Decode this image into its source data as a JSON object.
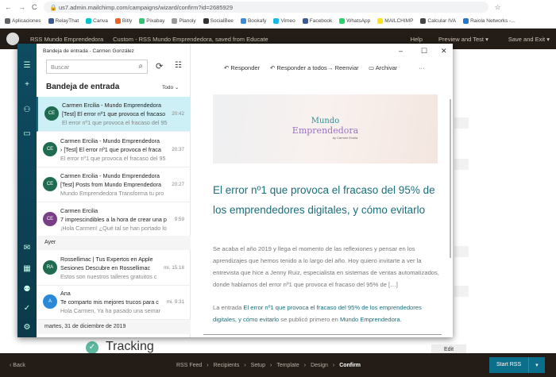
{
  "browser": {
    "url": "us7.admin.mailchimp.com/campaigns/wizard/confirm?id=2685929",
    "bookmarks": [
      "Aplicaciones",
      "RelayThat",
      "Canva",
      "Bitly",
      "Pixabay",
      "Planoly",
      "SocialBee",
      "Bookafy",
      "Vimeo",
      "Facebook",
      "WhatsApp",
      "MAILCHIMP",
      "Calcular IVA",
      "Raiola Networks -..."
    ]
  },
  "mailchimp": {
    "campaign": "RSS Mundo Emprendedora",
    "template": "Custom - RSS Mundo Emprendedora, saved from Educate",
    "help": "Help",
    "preview": "Preview and Test ▾",
    "save": "Save and Exit ▾",
    "tracking": "Tracking",
    "edit": "Edit",
    "footer": {
      "back": "‹ Back",
      "steps": [
        "RSS Feed",
        "Recipients",
        "Setup",
        "Template",
        "Design",
        "Confirm"
      ],
      "start": "Start RSS",
      "start_menu": "▾"
    }
  },
  "mail": {
    "window_title": "Bandeja de entrada - Carmen González",
    "search_placeholder": "Buscar",
    "folder": "Bandeja de entrada",
    "filter": "Todo",
    "emails": [
      {
        "initials": "CE",
        "color": "#1e6b4f",
        "from": "Carmen Ercilia - Mundo Emprendedora",
        "subject": "[Test] El error nº1 que provoca el fracaso",
        "preview": "El error nº1 que provoca el fracaso del 95",
        "time": "20:42",
        "selected": true
      },
      {
        "initials": "CE",
        "color": "#1e6b4f",
        "from": "Carmen Ercilia - Mundo Emprendedora",
        "subject": "› [Test] El error nº1 que provoca el fraca",
        "preview": "El error nº1 que provoca el fracaso del 95",
        "time": "20:37"
      },
      {
        "initials": "CE",
        "color": "#1e6b4f",
        "from": "Carmen Ercilia - Mundo Emprendedora",
        "subject": "[Test] Posts from Mundo Emprendedora",
        "preview": "Mundo Emprendedora Transforma tu pro",
        "time": "20:27"
      },
      {
        "initials": "CE",
        "color": "#7a3e86",
        "from": "Carmen Ercilia",
        "subject": "7 imprescindibles a la hora de crear una p",
        "preview": "¡Hola Carmen! ¿Qué tal se han portado lo",
        "time": "9:59"
      }
    ],
    "group_yesterday": "Ayer",
    "emails_yesterday": [
      {
        "initials": "RA",
        "color": "#1e6b4f",
        "from": "Rossellimac | Tus Expertos en Apple",
        "subject": "Sesiones Descubre en Rossellimac",
        "preview": "Estos son nuestros talleres gratuitos c",
        "time": "mi. 15:18"
      },
      {
        "initials": "A",
        "color": "#2b88d8",
        "from": "Ana",
        "subject": "Te comparto mis mejores trucos para c",
        "preview": "Hola Carmen, Ya ha pasado una semar",
        "time": "mi. 9:31"
      }
    ],
    "group_date": "martes, 31 de diciembre de 2019",
    "toolbar": {
      "reply": "Responder",
      "reply_all": "Responder a todos",
      "forward": "Reenviar",
      "archive": "Archivar",
      "more": "···"
    },
    "message": {
      "logo_line1": "Mundo",
      "logo_line2": "Emprendedora",
      "logo_by": "by Carmen Ercilia",
      "title": "El error nº1 que provoca el fracaso del 95% de los emprendedores digitales, y cómo evitarlo",
      "body": "Se acaba el año 2019 y llega el momento de las reflexiones y pensar en los aprendizajes que hemos tenido a lo largo del año. Hoy quiero invitarte a ver la entrevista que hice a Jenny Ruiz, especialista en sistemas de ventas automatizados, donde hablamos del error nº1 que provoca el fracaso del 95% de […]",
      "footer_pre": "La entrada ",
      "footer_link": "El error nº1 que provoca el fracaso del 95% de los emprendedores digitales, y cómo evitarlo",
      "footer_mid": " se publicó primero en ",
      "footer_site": "Mundo Emprendedora",
      "footer_end": "."
    }
  },
  "colors": {
    "accent": "#1b6f7c",
    "mc_dark": "#241d17",
    "start_btn": "#0b6e8a"
  }
}
